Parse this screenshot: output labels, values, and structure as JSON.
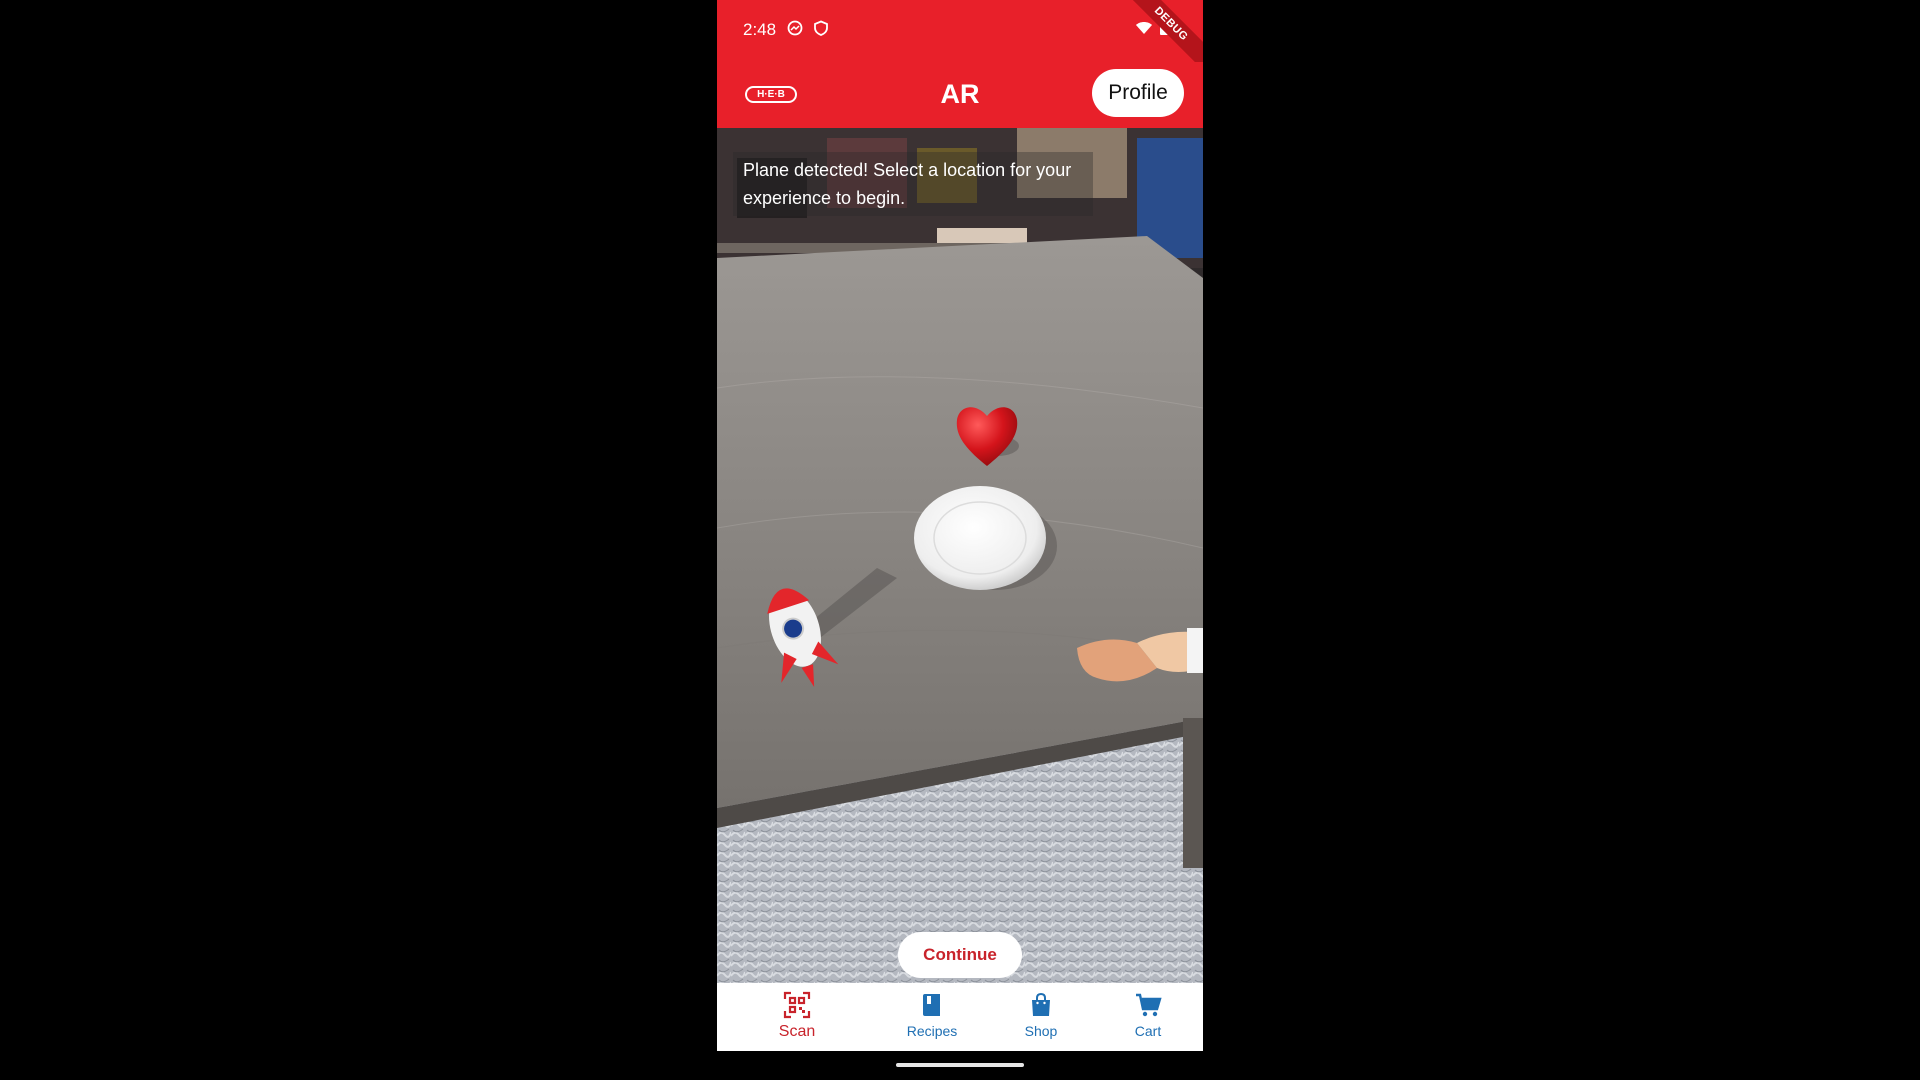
{
  "status_bar": {
    "time": "2:48",
    "icons": [
      "photo-icon",
      "shield-icon",
      "wifi-icon",
      "battery-icon"
    ],
    "debug_label": "DEBUG"
  },
  "app_bar": {
    "logo_text": "H·E·B",
    "title": "AR",
    "profile_label": "Profile"
  },
  "ar_view": {
    "instruction": "Plane detected! Select a location for your experience to begin.",
    "objects": [
      "heart-icon",
      "plate",
      "rocket-icon",
      "handshake-icon"
    ],
    "continue_label": "Continue"
  },
  "bottom_nav": {
    "items": [
      {
        "label": "Scan",
        "icon": "qr-scan-icon",
        "active": true
      },
      {
        "label": "Recipes",
        "icon": "book-icon",
        "active": false
      },
      {
        "label": "Shop",
        "icon": "shopping-bag-icon",
        "active": false
      },
      {
        "label": "Cart",
        "icon": "cart-icon",
        "active": false
      }
    ]
  },
  "colors": {
    "brand_red": "#e8202a",
    "nav_active": "#c8232b",
    "nav_inactive": "#1f6fb3"
  }
}
